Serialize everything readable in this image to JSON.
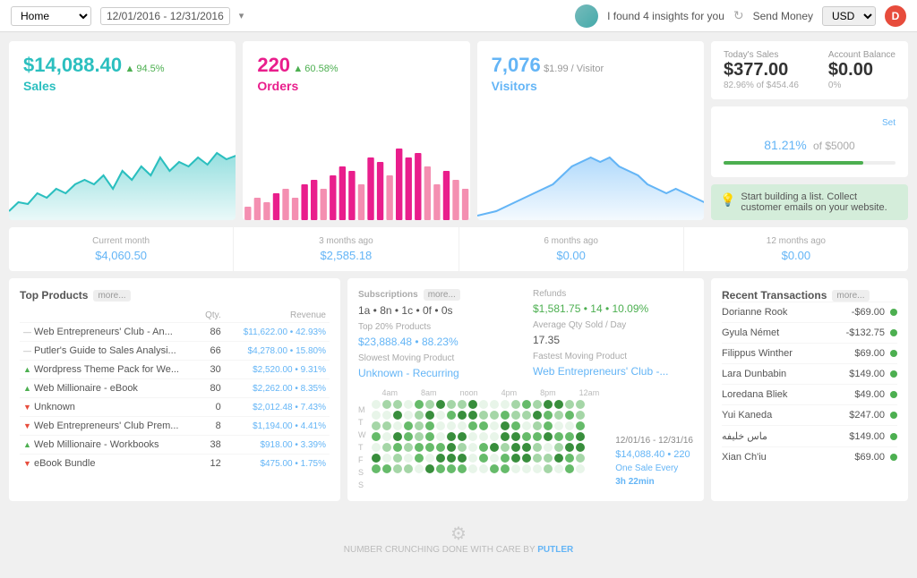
{
  "header": {
    "home_label": "Home",
    "date_range": "12/01/2016 - 12/31/2016",
    "insights_text": "I found 4 insights for you",
    "send_money": "Send Money",
    "currency": "USD",
    "user_initial": "D"
  },
  "top_stats": {
    "sales": {
      "value": "$14,088.40",
      "change": "94.5%",
      "label": "Sales"
    },
    "orders": {
      "value": "220",
      "change": "60.58%",
      "label": "Orders"
    },
    "visitors": {
      "value": "7,076",
      "sub": "$1.99 / Visitor",
      "label": "Visitors"
    }
  },
  "right_cards": {
    "todays_sales_label": "Today's Sales",
    "todays_sales_value": "$377.00",
    "todays_sales_sub": "82.96% of $454.46",
    "account_balance_label": "Account Balance",
    "account_balance_value": "$0.00",
    "account_balance_sub": "0%",
    "goal_pct": "81.21",
    "goal_of": "of $5000",
    "goal_set": "Set",
    "tip_text": "Start building a list. Collect customer emails on your website."
  },
  "period_row": {
    "current_month_label": "Current month",
    "current_month_value": "$4,060.50",
    "three_months_label": "3 months ago",
    "three_months_value": "$2,585.18",
    "six_months_label": "6 months ago",
    "six_months_value": "$0.00",
    "twelve_months_label": "12 months ago",
    "twelve_months_value": "$0.00"
  },
  "products": {
    "title": "Top Products",
    "more": "more...",
    "col_qty": "Qty.",
    "col_revenue": "Revenue",
    "items": [
      {
        "name": "Web Entrepreneurs' Club - An...",
        "trend": "neutral",
        "qty": 86,
        "revenue": "$11,622.00",
        "pct": "42.93%"
      },
      {
        "name": "Putler's Guide to Sales Analysi...",
        "trend": "neutral",
        "qty": 66,
        "revenue": "$4,278.00",
        "pct": "15.80%"
      },
      {
        "name": "Wordpress Theme Pack for We...",
        "trend": "up",
        "qty": 30,
        "revenue": "$2,520.00",
        "pct": "9.31%"
      },
      {
        "name": "Web Millionaire - eBook",
        "trend": "up",
        "qty": 80,
        "revenue": "$2,262.00",
        "pct": "8.35%"
      },
      {
        "name": "Unknown",
        "trend": "down",
        "qty": 0,
        "revenue": "$2,012.48",
        "pct": "7.43%"
      },
      {
        "name": "Web Entrepreneurs' Club Prem...",
        "trend": "down",
        "qty": 8,
        "revenue": "$1,194.00",
        "pct": "4.41%"
      },
      {
        "name": "Web Millionaire - Workbooks",
        "trend": "up",
        "qty": 38,
        "revenue": "$918.00",
        "pct": "3.39%"
      },
      {
        "name": "eBook Bundle",
        "trend": "down",
        "qty": 12,
        "revenue": "$475.00",
        "pct": "1.75%"
      }
    ]
  },
  "middle_card": {
    "subscriptions_label": "Subscriptions",
    "subscriptions_more": "more...",
    "subscriptions_value": "1a • 8n • 1c • 0f • 0s",
    "top20_label": "Top 20% Products",
    "top20_value": "$23,888.48",
    "top20_pct": "88.23%",
    "slowest_label": "Slowest Moving Product",
    "slowest_value": "Unknown - Recurring",
    "refunds_label": "Refunds",
    "refunds_value": "$1,581.75",
    "refunds_count": "14",
    "refunds_pct": "10.09%",
    "avg_qty_label": "Average Qty Sold / Day",
    "avg_qty_value": "17.35",
    "fastest_label": "Fastest Moving Product",
    "fastest_value": "Web Entrepreneurs' Club -...",
    "heatmap_date": "12/01/16 - 12/31/16",
    "heatmap_stats": "$14,088.40 • 220",
    "heatmap_sale": "One Sale Every",
    "heatmap_sale2": "3h 22min",
    "days": [
      "M",
      "T",
      "W",
      "T",
      "F",
      "S",
      "S"
    ],
    "hours": [
      "4am",
      "8am",
      "noon",
      "4pm",
      "8pm",
      "12am"
    ]
  },
  "transactions": {
    "title": "Recent Transactions",
    "more": "more...",
    "items": [
      {
        "name": "Dorianne Rook",
        "amount": "-$69.00",
        "positive": true
      },
      {
        "name": "Gyula Német",
        "amount": "-$132.75",
        "positive": true
      },
      {
        "name": "Filippus Winther",
        "amount": "$69.00",
        "positive": true
      },
      {
        "name": "Lara Dunbabin",
        "amount": "$149.00",
        "positive": true
      },
      {
        "name": "Loredana Bliek",
        "amount": "$49.00",
        "positive": true
      },
      {
        "name": "Yui Kaneda",
        "amount": "$247.00",
        "positive": true
      },
      {
        "name": "ماس خليفه",
        "amount": "$149.00",
        "positive": true
      },
      {
        "name": "Xian Ch'iu",
        "amount": "$69.00",
        "positive": true
      }
    ]
  },
  "footer": {
    "text": "NUMBER CRUNCHING DONE WITH CARE BY",
    "brand": "PUTLER"
  }
}
